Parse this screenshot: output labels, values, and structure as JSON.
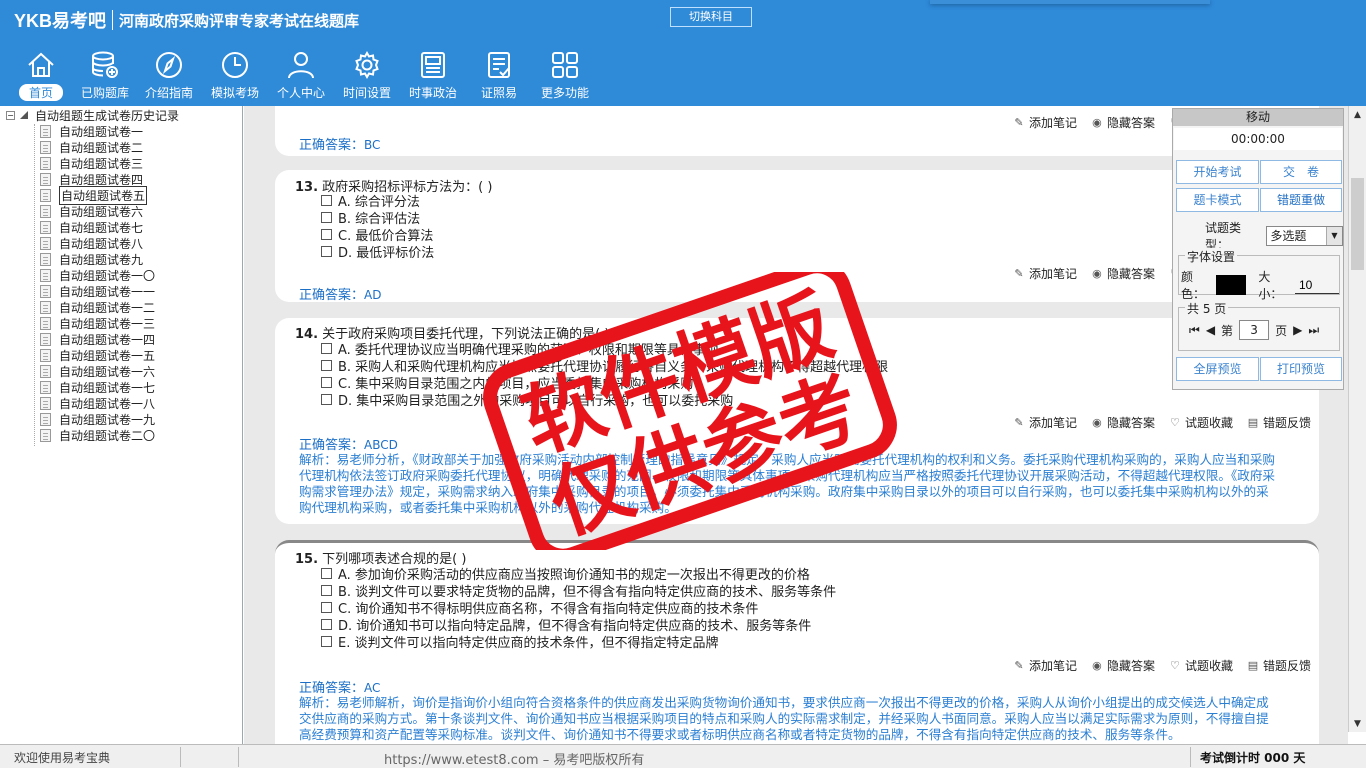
{
  "header": {
    "logo": "YKB易考吧",
    "title": "河南政府采购评审专家考试在线题库",
    "switch_label": "切换科目"
  },
  "nav": [
    {
      "label": "首页",
      "icon": "home-icon"
    },
    {
      "label": "已购题库",
      "icon": "database-icon"
    },
    {
      "label": "介绍指南",
      "icon": "compass-icon"
    },
    {
      "label": "模拟考场",
      "icon": "clock-icon"
    },
    {
      "label": "个人中心",
      "icon": "user-icon"
    },
    {
      "label": "时间设置",
      "icon": "gear-icon"
    },
    {
      "label": "时事政治",
      "icon": "newspaper-icon"
    },
    {
      "label": "证照易",
      "icon": "checklist-icon"
    },
    {
      "label": "更多功能",
      "icon": "grid-icon"
    }
  ],
  "tree": {
    "root": "自动组题生成试卷历史记录",
    "items": [
      "自动组题试卷一",
      "自动组题试卷二",
      "自动组题试卷三",
      "自动组题试卷四",
      "自动组题试卷五",
      "自动组题试卷六",
      "自动组题试卷七",
      "自动组题试卷八",
      "自动组题试卷九",
      "自动组题试卷一〇",
      "自动组题试卷一一",
      "自动组题试卷一二",
      "自动组题试卷一三",
      "自动组题试卷一四",
      "自动组题试卷一五",
      "自动组题试卷一六",
      "自动组题试卷一七",
      "自动组题试卷一八",
      "自动组题试卷一九",
      "自动组题试卷二〇"
    ],
    "selected_index": 4
  },
  "tools": {
    "note": "添加笔记",
    "hide": "隐藏答案",
    "fav": "试题收藏",
    "feedback": "错题反馈"
  },
  "answer_label": "正确答案：",
  "questions": {
    "q12": {
      "answer": "BC"
    },
    "q13": {
      "num": "13.",
      "text": "政府采购招标评标方法为：( )",
      "options": [
        "A. 综合评分法",
        "B. 综合评估法",
        "C. 最低价合算法",
        "D. 最低评标价法"
      ],
      "answer": "AD"
    },
    "q14": {
      "num": "14.",
      "text": "关于政府采购项目委托代理，下列说法正确的是( )",
      "options": [
        "A. 委托代理协议应当明确代理采购的范围、权限和期限等具体事项",
        "B. 采购人和采购代理机构应当按照委托代理协议履行各自义务，采购代理机构不得超越代理权限",
        "C. 集中采购目录范围之内的项目，应当委托集中采购机构采购",
        "D. 集中采购目录范围之外的采购项目可以自行采购，也可以委托采购"
      ],
      "answer": "ABCD",
      "analysis": "解析：易老师分析，《财政部关于加强政府采购活动内部控制管理的指导意见》规定，采购人应当明确委托代理机构的权利和义务。委托采购代理机构采购的，采购人应当和采购代理机构依法签订政府采购委托代理协议，明确代理采购的范围、权限和期限等具体事项。采购代理机构应当严格按照委托代理协议开展采购活动，不得超越代理权限。《政府采购需求管理办法》规定，采购需求纳入政府集中采购目录的项目，必须委托集中采购机构采购。政府集中采购目录以外的项目可以自行采购，也可以委托集中采购机构以外的采购代理机构采购，或者委托集中采购机构以外的采购代理机构采购。"
    },
    "q15": {
      "num": "15.",
      "text": "下列哪项表述合规的是( )",
      "options": [
        "A. 参加询价采购活动的供应商应当按照询价通知书的规定一次报出不得更改的价格",
        "B. 谈判文件可以要求特定货物的品牌，但不得含有指向特定供应商的技术、服务等条件",
        "C. 询价通知书不得标明供应商名称，不得含有指向特定供应商的技术条件",
        "D. 询价通知书可以指向特定品牌，但不得含有指向特定供应商的技术、服务等条件",
        "E. 谈判文件可以指向特定供应商的技术条件，但不得指定特定品牌"
      ],
      "answer": "AC",
      "analysis": "解析：易老师解析，询价是指询价小组向符合资格条件的供应商发出采购货物询价通知书，要求供应商一次报出不得更改的价格，采购人从询价小组提出的成交候选人中确定成交供应商的采购方式。第十条谈判文件、询价通知书应当根据采购项目的特点和采购人的实际需求制定，并经采购人书面同意。采购人应当以满足实际需求为原则，不得擅自提高经费预算和资产配置等采购标准。谈判文件、询价通知书不得要求或者标明供应商名称或者特定货物的品牌，不得含有指向特定供应商的技术、服务等条件。"
    }
  },
  "panel": {
    "move": "移动",
    "timer": "00:00:00",
    "start_exam": "开始考试",
    "submit": "交　卷",
    "card_mode": "题卡模式",
    "wrong_redo": "错题重做",
    "type_label": "试题类型：",
    "type_value": "多选题",
    "font_legend": "字体设置",
    "color_label": "颜色：",
    "size_label": "大小：",
    "size_value": "10",
    "color_value": "#000000",
    "pages_legend": "共 5 页",
    "page_prefix": "第",
    "page_value": "3",
    "page_suffix": "页",
    "fullscreen": "全屏预览",
    "print": "打印预览"
  },
  "status": {
    "welcome": "欢迎使用易考宝典",
    "url": "https://www.etest8.com – 易考吧版权所有",
    "countdown": "考试倒计时 000 天"
  },
  "stamp": {
    "line1": "软件模版",
    "line2": "仅供参考",
    "color": "#e8141c"
  }
}
